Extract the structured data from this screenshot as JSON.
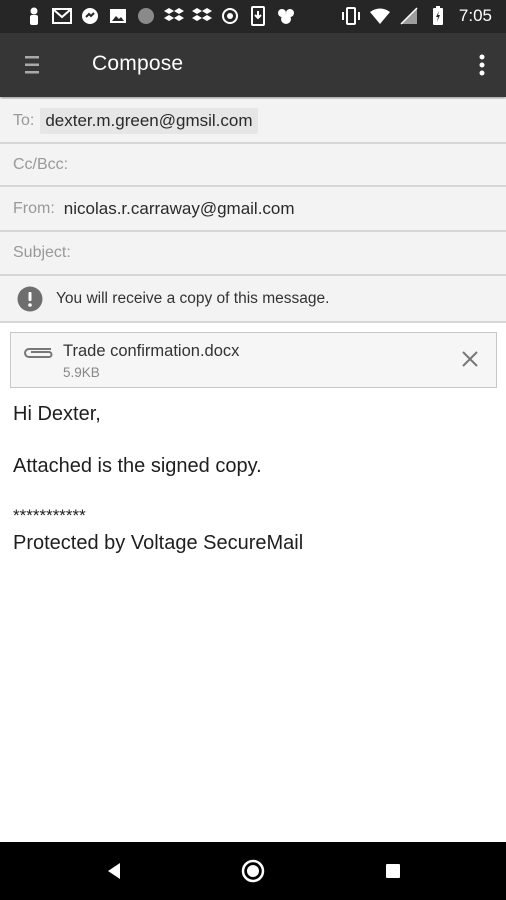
{
  "status_bar": {
    "time": "7:05",
    "left_icons": [
      "person-icon",
      "gmail-icon",
      "sync-icon",
      "image-icon",
      "circle-icon",
      "dropbox-icon",
      "dropbox-icon",
      "target-icon",
      "download-icon",
      "puzzle-icon"
    ],
    "right_icons": [
      "vibrate-icon",
      "wifi-icon",
      "signal-icon",
      "battery-icon"
    ]
  },
  "app_bar": {
    "title": "Compose",
    "menu_icon": "menu-icon",
    "overflow_icon": "more-vert-icon"
  },
  "compose": {
    "to_label": "To:",
    "to_value": "dexter.m.green@gmsil.com",
    "cc_label": "Cc/Bcc:",
    "from_label": "From:",
    "from_value": "nicolas.r.carraway@gmail.com",
    "subject_label": "Subject:"
  },
  "notice": {
    "icon": "alert-icon",
    "text": "You will receive a copy of this message."
  },
  "attachment": {
    "icon": "paperclip-icon",
    "name": "Trade confirmation.docx",
    "size": "5.9KB",
    "remove_icon": "close-icon"
  },
  "message_body": {
    "greeting": "Hi Dexter,",
    "line1": "Attached is the signed copy.",
    "separator": "***********",
    "signature": "Protected by Voltage SecureMail"
  },
  "nav_bar": {
    "icons": [
      "back-icon",
      "home-icon",
      "recents-icon"
    ]
  }
}
